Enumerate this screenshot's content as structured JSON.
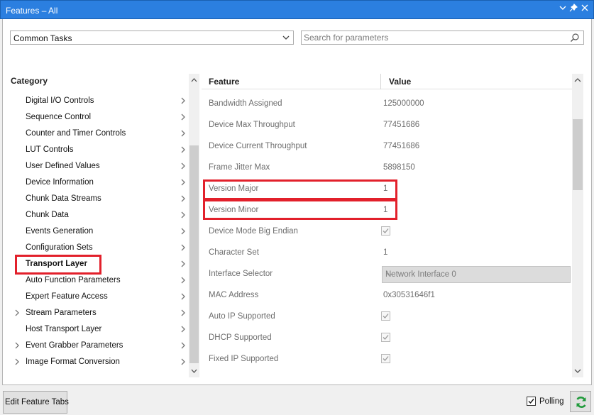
{
  "window": {
    "title": "Features – All",
    "controls": [
      "chevron-down-icon",
      "pin-icon",
      "close-icon"
    ]
  },
  "toolbar": {
    "category_dropdown_value": "Common Tasks",
    "search_placeholder": "Search for parameters"
  },
  "category": {
    "header": "Category",
    "items": [
      {
        "label": "Digital I/O Controls",
        "expander": false,
        "selected": false
      },
      {
        "label": "Sequence Control",
        "expander": false,
        "selected": false
      },
      {
        "label": "Counter and Timer Controls",
        "expander": false,
        "selected": false
      },
      {
        "label": "LUT Controls",
        "expander": false,
        "selected": false
      },
      {
        "label": "User Defined Values",
        "expander": false,
        "selected": false
      },
      {
        "label": "Device Information",
        "expander": false,
        "selected": false
      },
      {
        "label": "Chunk Data Streams",
        "expander": false,
        "selected": false
      },
      {
        "label": "Chunk Data",
        "expander": false,
        "selected": false
      },
      {
        "label": "Events Generation",
        "expander": false,
        "selected": false
      },
      {
        "label": "Configuration Sets",
        "expander": false,
        "selected": false
      },
      {
        "label": "Transport Layer",
        "expander": false,
        "selected": true
      },
      {
        "label": "Auto Function Parameters",
        "expander": false,
        "selected": false
      },
      {
        "label": "Expert Feature Access",
        "expander": false,
        "selected": false
      },
      {
        "label": "Stream Parameters",
        "expander": true,
        "selected": false
      },
      {
        "label": "Host Transport Layer",
        "expander": false,
        "selected": false
      },
      {
        "label": "Event Grabber Parameters",
        "expander": true,
        "selected": false
      },
      {
        "label": "Image Format Conversion",
        "expander": true,
        "selected": false
      }
    ]
  },
  "features": {
    "header_feature": "Feature",
    "header_value": "Value",
    "rows": [
      {
        "name": "Bandwidth Assigned",
        "type": "text",
        "value": "125000000"
      },
      {
        "name": "Device Max Throughput",
        "type": "text",
        "value": "77451686"
      },
      {
        "name": "Device Current Throughput",
        "type": "text",
        "value": "77451686"
      },
      {
        "name": "Frame Jitter Max",
        "type": "text",
        "value": "5898150"
      },
      {
        "name": "Version Major",
        "type": "text",
        "value": "1"
      },
      {
        "name": "Version Minor",
        "type": "text",
        "value": "1"
      },
      {
        "name": "Device Mode Big Endian",
        "type": "check",
        "value": "checked"
      },
      {
        "name": "Character Set",
        "type": "text",
        "value": "1"
      },
      {
        "name": "Interface Selector",
        "type": "combo",
        "value": "Network Interface 0"
      },
      {
        "name": "MAC Address",
        "type": "text",
        "value": "0x30531646f1"
      },
      {
        "name": "Auto IP Supported",
        "type": "check",
        "value": "checked"
      },
      {
        "name": "DHCP Supported",
        "type": "check",
        "value": "checked"
      },
      {
        "name": "Fixed IP Supported",
        "type": "check",
        "value": "checked"
      }
    ]
  },
  "bottom": {
    "edit_button": "Edit Feature Tabs",
    "polling_label": "Polling",
    "polling_checked": true
  },
  "colors": {
    "titlebar": "#2b7fe0",
    "highlight": "#e2202b",
    "refresh_icon": "#1f9a3a"
  }
}
